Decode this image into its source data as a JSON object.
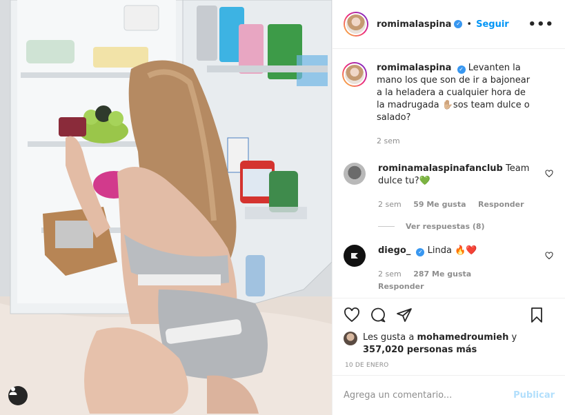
{
  "post": {
    "username": "romimalaspina",
    "follow_label": "Seguir",
    "more_icon": "more-horizontal-icon",
    "separator": "•"
  },
  "caption": {
    "username": "romimalaspina",
    "text": "Levanten la mano los que son de ir a bajonear a la heladera a cualquier hora de la madrugada ✋🏼sos team dulce o salado?",
    "time": "2 sem"
  },
  "comments": [
    {
      "username": "rominamalaspinafanclub",
      "text": "Team dulce tu?💚",
      "time": "2 sem",
      "likes": "59 Me gusta",
      "reply_label": "Responder",
      "view_replies": "Ver respuestas (8)"
    },
    {
      "username": "diego_",
      "text": "Linda 🔥❤️",
      "time": "2 sem",
      "likes": "287 Me gusta",
      "reply_label": "Responder"
    }
  ],
  "likes": {
    "prefix": "Les gusta a",
    "user": "mohamedroumieh",
    "joiner": "y",
    "count": "357,020 personas más"
  },
  "date": "10 DE ENERO",
  "add_comment": {
    "placeholder": "Agrega un comentario...",
    "publish_label": "Publicar"
  },
  "colors": {
    "accent": "#0095f6",
    "verified": "#3897f0",
    "publish_disabled": "#b2dffc",
    "muted": "#8e8e8e"
  }
}
